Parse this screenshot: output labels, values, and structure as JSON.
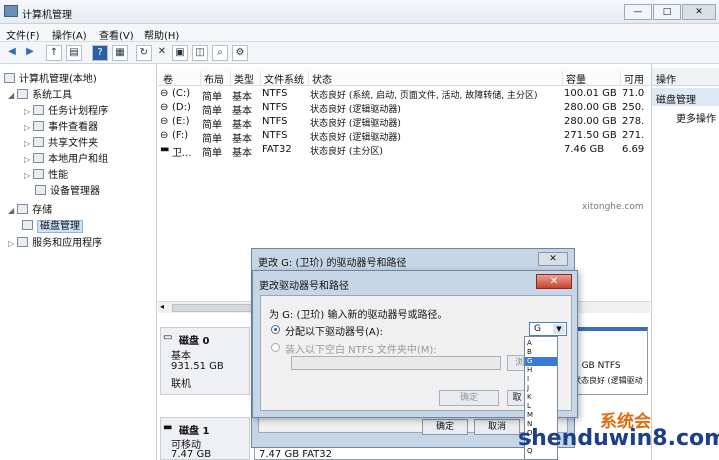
{
  "window": {
    "title": "计算机管理",
    "controls": [
      "—",
      "□",
      "✕"
    ]
  },
  "menu": [
    {
      "label": "文件(F)"
    },
    {
      "label": "操作(A)"
    },
    {
      "label": "查看(V)"
    },
    {
      "label": "帮助(H)"
    }
  ],
  "toolbar": {
    "icons": [
      "back-icon",
      "forward-icon",
      "up-icon",
      "show-hide-tree-icon",
      "help-icon",
      "view-icon",
      "refresh-icon",
      "delete-icon",
      "properties-icon",
      "open-icon",
      "search-icon",
      "settings-icon"
    ]
  },
  "tree": {
    "root": "计算机管理(本地)",
    "system_tools": "系统工具",
    "items": [
      "任务计划程序",
      "事件查看器",
      "共享文件夹",
      "本地用户和组",
      "性能",
      "设备管理器"
    ],
    "storage": "存储",
    "disk_management": "磁盘管理",
    "services": "服务和应用程序"
  },
  "list": {
    "headers": [
      "卷",
      "布局",
      "类型",
      "文件系统",
      "状态",
      "容量",
      "可用"
    ],
    "rows": [
      {
        "vol": "(C:)",
        "layout": "简单",
        "type": "基本",
        "fs": "NTFS",
        "status": "状态良好 (系统, 启动, 页面文件, 活动, 故障转储, 主分区)",
        "capacity": "100.01 GB",
        "free": "71.0"
      },
      {
        "vol": "(D:)",
        "layout": "简单",
        "type": "基本",
        "fs": "NTFS",
        "status": "状态良好 (逻辑驱动器)",
        "capacity": "280.00 GB",
        "free": "250."
      },
      {
        "vol": "(E:)",
        "layout": "简单",
        "type": "基本",
        "fs": "NTFS",
        "status": "状态良好 (逻辑驱动器)",
        "capacity": "280.00 GB",
        "free": "278."
      },
      {
        "vol": "(F:)",
        "layout": "简单",
        "type": "基本",
        "fs": "NTFS",
        "status": "状态良好 (逻辑驱动器)",
        "capacity": "271.50 GB",
        "free": "271."
      },
      {
        "vol": "卫...",
        "layout": "简单",
        "type": "基本",
        "fs": "FAT32",
        "status": "状态良好 (主分区)",
        "capacity": "7.46 GB",
        "free": "6.69"
      }
    ]
  },
  "disks": [
    {
      "name": "磁盘 0",
      "type": "基本",
      "size": "931.51 GB",
      "status": "联机"
    },
    {
      "name": "磁盘 1",
      "type": "可移动",
      "size": "7.47 GB",
      "status": ""
    }
  ],
  "disk_partial": {
    "part_fs": "0 GB NTFS",
    "part_status": "状态良好 (逻辑驱动",
    "bottom_part": "7.47 GB FAT32"
  },
  "actions": {
    "header": "操作",
    "section": "磁盘管理",
    "more": "更多操作"
  },
  "dialog_outer": {
    "title": "更改 G: (卫玠) 的驱动器号和路径",
    "ok": "确定",
    "cancel": "取消"
  },
  "dialog_inner": {
    "title": "更改驱动器号和路径",
    "close": "✕",
    "prompt": "为 G: (卫玠) 输入新的驱动器号或路径。",
    "opt_letter": "分配以下驱动器号(A):",
    "opt_folder": "装入以下空白 NTFS 文件夹中(M):",
    "browse": "浏览(",
    "ok": "确定",
    "cancel": "取",
    "selected_letter": "G"
  },
  "dropdown": [
    "A",
    "B",
    "G",
    "H",
    "I",
    "J",
    "K",
    "L",
    "M",
    "N",
    "O",
    "P",
    "Q"
  ],
  "dropdown_selected": "G",
  "watermark": {
    "text": "shenduwin8.com",
    "brand": "系统会",
    "small": "xitonghe.com"
  }
}
